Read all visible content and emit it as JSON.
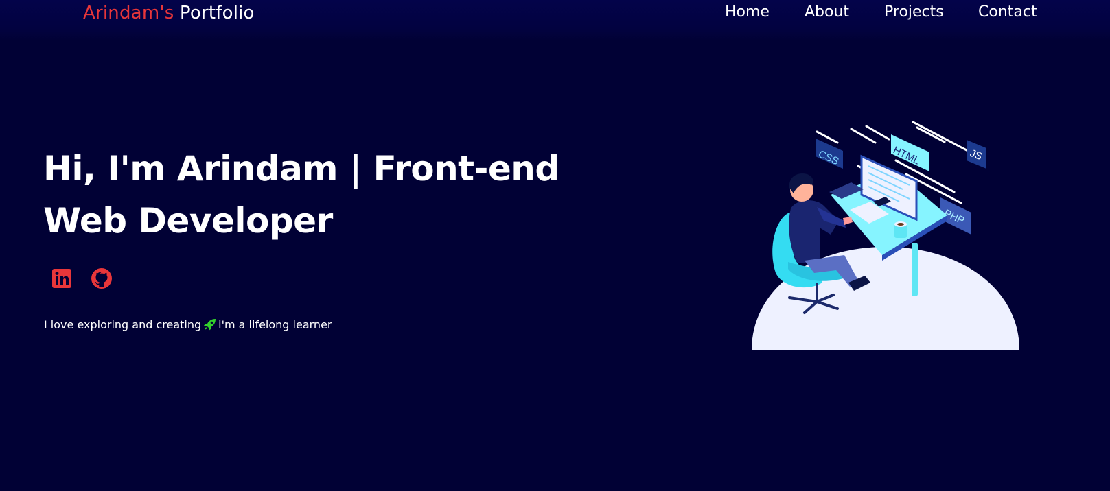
{
  "nav": {
    "brand_accent": "Arindam's",
    "brand_rest": " Portfolio",
    "links": [
      {
        "label": "Home"
      },
      {
        "label": "About"
      },
      {
        "label": "Projects"
      },
      {
        "label": "Contact"
      }
    ]
  },
  "hero": {
    "title_line1": "Hi, I'm Arindam | Front-end",
    "title_line2": "Web Developer",
    "tagline_before": "I love exploring and creating",
    "tagline_emoji_icon": "rocket-icon",
    "tagline_after": "i'm a lifelong learner",
    "social": [
      {
        "icon": "linkedin-icon"
      },
      {
        "icon": "github-icon"
      }
    ],
    "illustration_tags": [
      "CSS",
      "HTML",
      "JS",
      "PHP"
    ]
  },
  "colors": {
    "background": "#010135",
    "accent": "#e8363a",
    "text": "#ffffff",
    "illustration_cyan": "#3fe0f5"
  }
}
